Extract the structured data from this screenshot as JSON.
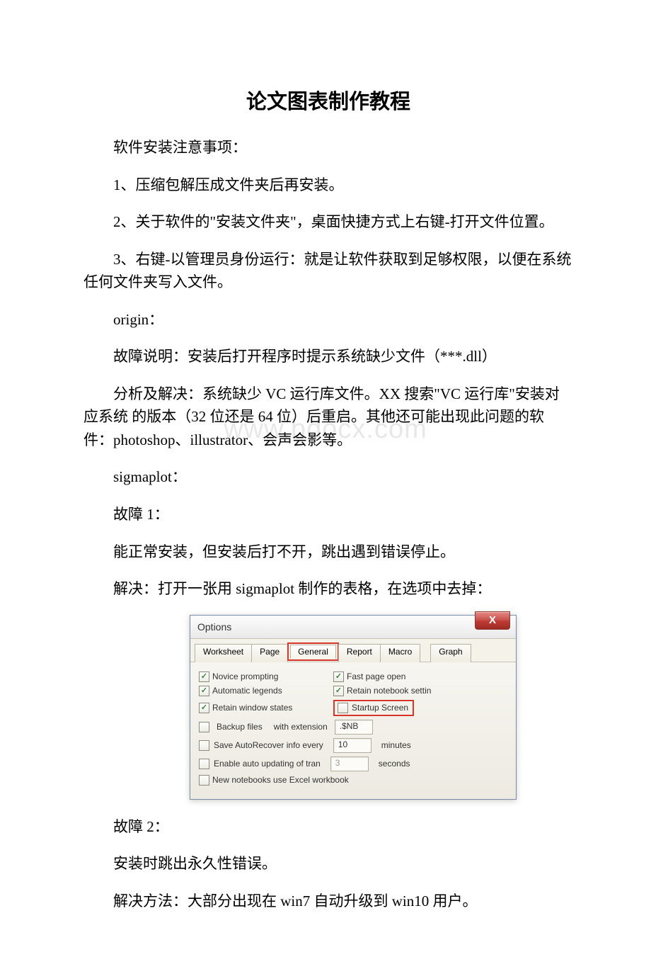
{
  "title": "论文图表制作教程",
  "p1": "软件安装注意事项：",
  "p2": "1、压缩包解压成文件夹后再安装。",
  "p3": "2、关于软件的\"安装文件夹\"，桌面快捷方式上右键-打开文件位置。",
  "p4": "3、右键-以管理员身份运行：就是让软件获取到足够权限，以便在系统任何文件夹写入文件。",
  "p5": "origin：",
  "p6": "故障说明：安装后打开程序时提示系统缺少文件（***.dll）",
  "p7": "分析及解决：系统缺少 VC 运行库文件。XX 搜索\"VC 运行库\"安装对应系统 的版本（32 位还是 64 位）后重启。其他还可能出现此问题的软件：photoshop、illustrator、会声会影等。",
  "p8": "sigmaplot：",
  "p9": "故障 1：",
  "p10": "能正常安装，但安装后打不开，跳出遇到错误停止。",
  "p11": "解决：打开一张用 sigmaplot 制作的表格，在选项中去掉：",
  "p12": "故障 2：",
  "p13": "安装时跳出永久性错误。",
  "p14": "解决方法：大部分出现在 win7 自动升级到 win10 用户。",
  "watermark": "www.bdocx.com",
  "options": {
    "title": "Options",
    "close": "X",
    "tabs": [
      "Worksheet",
      "Page",
      "General",
      "Report",
      "Macro",
      "Graph"
    ],
    "checks": {
      "novice": "Novice prompting",
      "fast": "Fast page open",
      "legends": "Automatic legends",
      "retain_nb": "Retain notebook settin",
      "win_states": "Retain window states",
      "startup": "Startup Screen",
      "backup": "Backup files",
      "backup_ext_lbl": "with extension",
      "backup_ext_val": ".$NB",
      "autorecover": "Save AutoRecover info every",
      "autorecover_val": "10",
      "autorecover_unit": "minutes",
      "auto_update": "Enable auto updating of tran",
      "auto_update_val": "3",
      "auto_update_unit": "seconds",
      "excel": "New notebooks use Excel workbook"
    }
  }
}
